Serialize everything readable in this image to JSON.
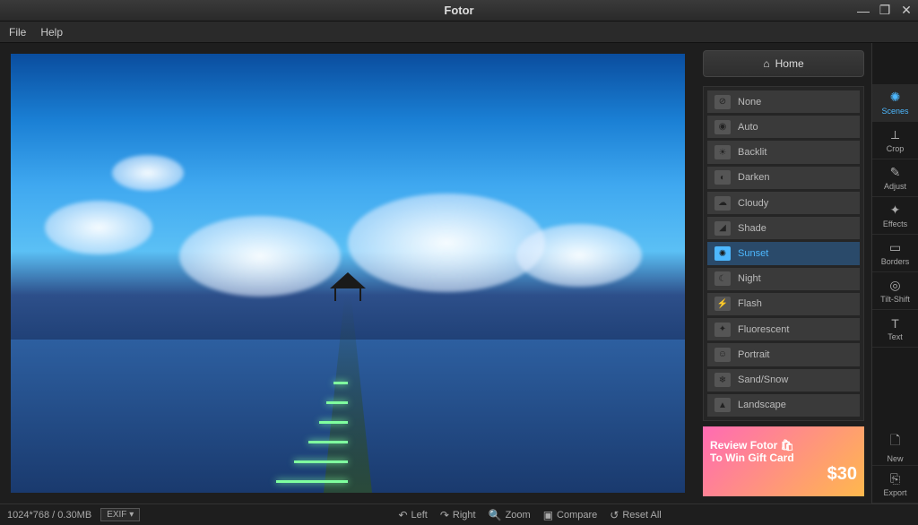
{
  "titlebar": {
    "title": "Fotor"
  },
  "menubar": {
    "file": "File",
    "help": "Help"
  },
  "home_button": "Home",
  "scenes": [
    {
      "label": "None",
      "icon": "⊘"
    },
    {
      "label": "Auto",
      "icon": "◉"
    },
    {
      "label": "Backlit",
      "icon": "☀"
    },
    {
      "label": "Darken",
      "icon": "◐"
    },
    {
      "label": "Cloudy",
      "icon": "☁"
    },
    {
      "label": "Shade",
      "icon": "◢"
    },
    {
      "label": "Sunset",
      "icon": "✺",
      "active": true
    },
    {
      "label": "Night",
      "icon": "☾"
    },
    {
      "label": "Flash",
      "icon": "⚡"
    },
    {
      "label": "Fluorescent",
      "icon": "✦"
    },
    {
      "label": "Portrait",
      "icon": "☺"
    },
    {
      "label": "Sand/Snow",
      "icon": "❄"
    },
    {
      "label": "Landscape",
      "icon": "▲"
    }
  ],
  "tools": [
    {
      "label": "Scenes",
      "icon": "✺",
      "active": true
    },
    {
      "label": "Crop",
      "icon": "⟂"
    },
    {
      "label": "Adjust",
      "icon": "✎"
    },
    {
      "label": "Effects",
      "icon": "✦"
    },
    {
      "label": "Borders",
      "icon": "▭"
    },
    {
      "label": "Tilt-Shift",
      "icon": "◎"
    },
    {
      "label": "Text",
      "icon": "T"
    }
  ],
  "tools_bottom": [
    {
      "label": "New",
      "icon": "🗋"
    },
    {
      "label": "Export",
      "icon": "⎘"
    }
  ],
  "promo": {
    "line1": "Review Fotor 🛍",
    "line2": "To Win Gift Card",
    "price": "$30"
  },
  "statusbar": {
    "dimensions": "1024*768 / 0.30MB",
    "exif": "EXIF ▾",
    "left_btn": "Left",
    "right_btn": "Right",
    "zoom_btn": "Zoom",
    "compare_btn": "Compare",
    "reset_btn": "Reset All"
  }
}
